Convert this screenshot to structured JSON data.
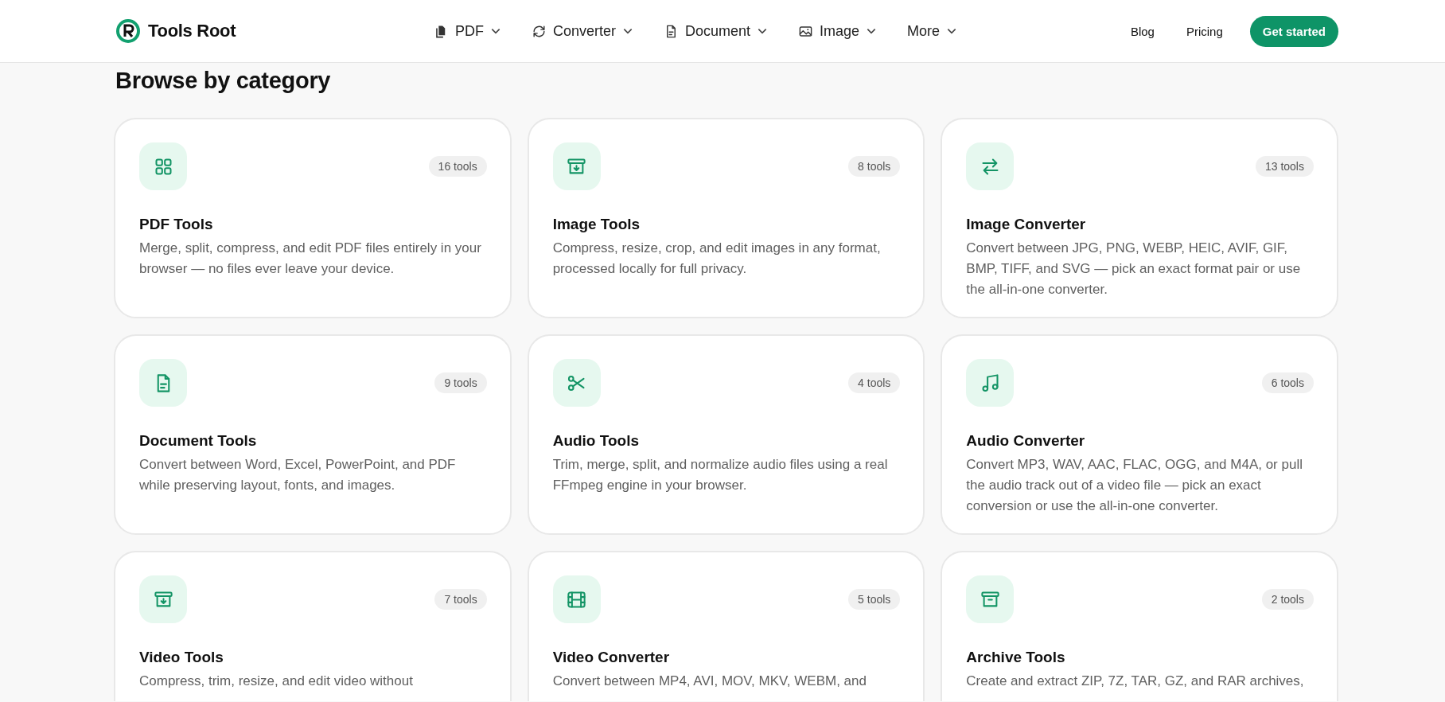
{
  "header": {
    "brand": "Tools Root",
    "nav": [
      {
        "label": "PDF"
      },
      {
        "label": "Converter"
      },
      {
        "label": "Document"
      },
      {
        "label": "Image"
      },
      {
        "label": "More"
      }
    ],
    "links": [
      "Blog",
      "Pricing"
    ],
    "cta": "Get started"
  },
  "section": {
    "title": "Browse by category",
    "categories": [
      {
        "count": "16 tools",
        "title": "PDF Tools",
        "description": "Merge, split, compress, and edit PDF files entirely in your browser — no files ever leave your device."
      },
      {
        "count": "8 tools",
        "title": "Image Tools",
        "description": "Compress, resize, crop, and edit images in any format, processed locally for full privacy."
      },
      {
        "count": "13 tools",
        "title": "Image Converter",
        "description": "Convert between JPG, PNG, WEBP, HEIC, AVIF, GIF, BMP, TIFF, and SVG — pick an exact format pair or use the all-in-one converter."
      },
      {
        "count": "9 tools",
        "title": "Document Tools",
        "description": "Convert between Word, Excel, PowerPoint, and PDF while preserving layout, fonts, and images."
      },
      {
        "count": "4 tools",
        "title": "Audio Tools",
        "description": "Trim, merge, split, and normalize audio files using a real FFmpeg engine in your browser."
      },
      {
        "count": "6 tools",
        "title": "Audio Converter",
        "description": "Convert MP3, WAV, AAC, FLAC, OGG, and M4A, or pull the audio track out of a video file — pick an exact conversion or use the all-in-one converter."
      },
      {
        "count": "7 tools",
        "title": "Video Tools",
        "description": "Compress, trim, resize, and edit video without"
      },
      {
        "count": "5 tools",
        "title": "Video Converter",
        "description": "Convert between MP4, AVI, MOV, MKV, WEBM, and"
      },
      {
        "count": "2 tools",
        "title": "Archive Tools",
        "description": "Create and extract ZIP, 7Z, TAR, GZ, and RAR archives,"
      }
    ]
  }
}
